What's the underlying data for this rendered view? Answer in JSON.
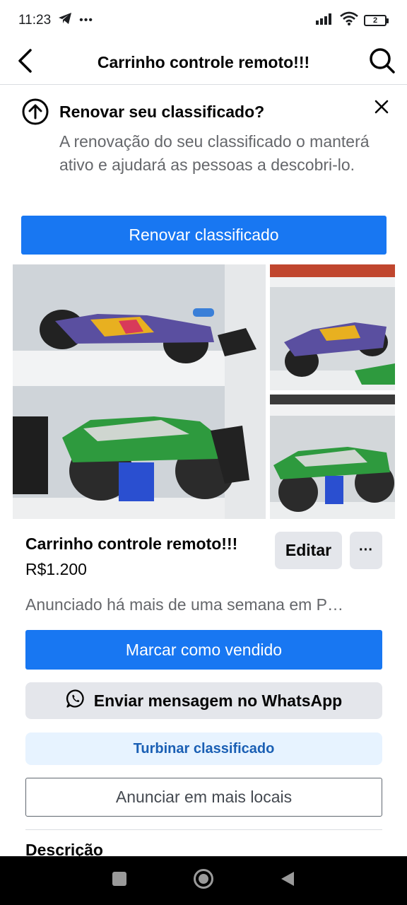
{
  "status_bar": {
    "time": "11:23",
    "dots": "•••",
    "battery_level": "2"
  },
  "header": {
    "title": "Carrinho controle remoto!!!"
  },
  "renew_banner": {
    "title": "Renovar seu classificado?",
    "text": "A renovação do seu classificado o manterá ativo e ajudará as pessoas a descobri-lo.",
    "button_label": "Renovar classificado"
  },
  "listing": {
    "title": "Carrinho controle remoto!!!",
    "price": "R$1.200",
    "edit_label": "Editar",
    "more_label": "···",
    "meta": "Anunciado há mais de uma semana em P…"
  },
  "actions": {
    "mark_sold": "Marcar como vendido",
    "whatsapp": "Enviar mensagem no WhatsApp",
    "boost": "Turbinar classificado",
    "more_places": "Anunciar em mais locais"
  },
  "description": {
    "heading": "Descrição"
  },
  "icons": {
    "back": "arrow-left-icon",
    "search": "search-icon",
    "renew": "arrow-up-circle-icon",
    "close": "close-icon",
    "whatsapp": "whatsapp-icon",
    "nav_recent": "square-icon",
    "nav_home": "circle-icon",
    "nav_back": "triangle-back-icon"
  },
  "colors": {
    "primary": "#1877f2",
    "secondary_button": "#e4e6eb",
    "boost_bg": "#e7f3ff",
    "boost_text": "#1a5fb4",
    "muted_text": "#65676b"
  }
}
